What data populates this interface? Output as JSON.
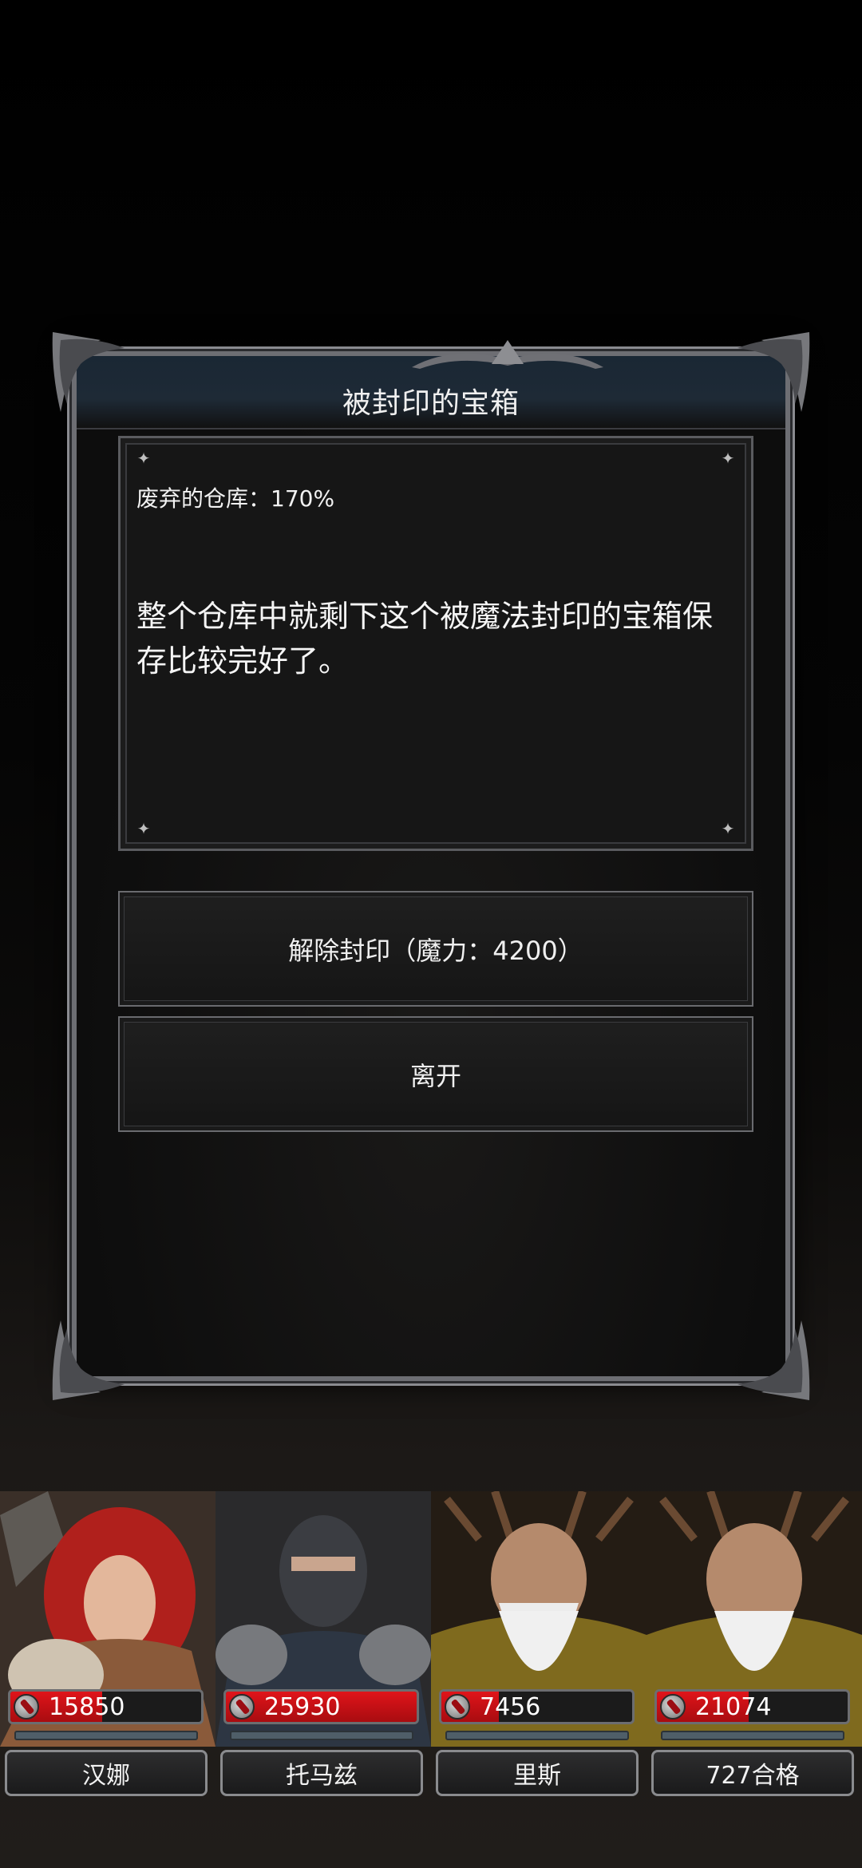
{
  "dialog": {
    "title": "被封印的宝箱",
    "location": "废弃的仓库：170%",
    "description": "整个仓库中就剩下这个被魔法封印的宝箱保存比较完好了。",
    "buttons": {
      "unseal": "解除封印（魔力：4200）",
      "leave": "离开"
    }
  },
  "party": [
    {
      "name": "汉娜",
      "hp": "15850",
      "hp_fill_percent": 48
    },
    {
      "name": "托马兹",
      "hp": "25930",
      "hp_fill_percent": 100
    },
    {
      "name": "里斯",
      "hp": "7456",
      "hp_fill_percent": 30
    },
    {
      "name": "727合格",
      "hp": "21074",
      "hp_fill_percent": 48
    }
  ],
  "colors": {
    "hp_red": "#e0141a",
    "frame_silver": "#8a8b90",
    "title_bar": "#1e2a36"
  },
  "icons": {
    "hp": "blood-drop-icon",
    "corner": "ornate-corner-icon",
    "panel_corner": "sparkle-icon"
  }
}
